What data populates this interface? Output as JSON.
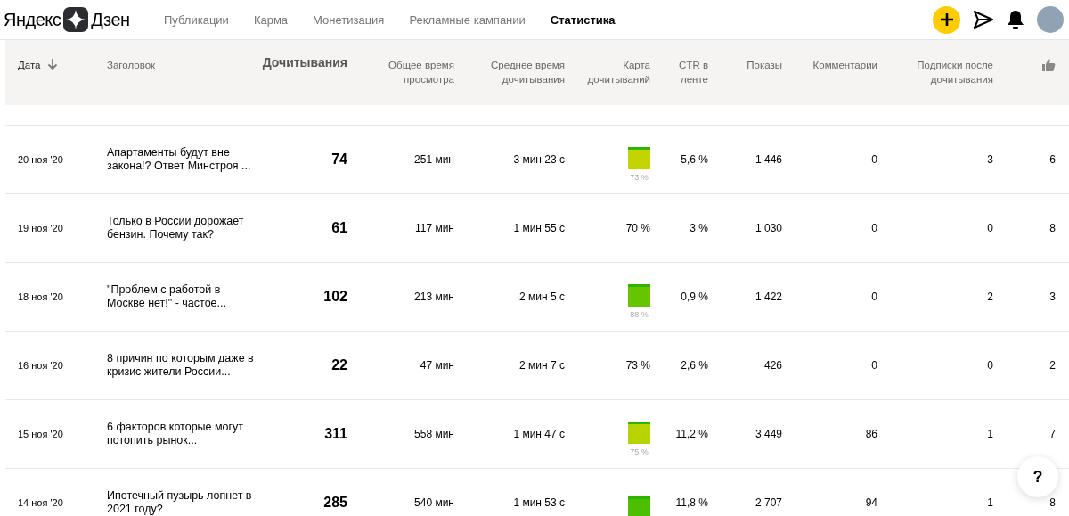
{
  "logo": {
    "left": "Яндекс",
    "right": "Дзен"
  },
  "nav": [
    {
      "label": "Публикации",
      "selected": false
    },
    {
      "label": "Карма",
      "selected": false
    },
    {
      "label": "Монетизация",
      "selected": false
    },
    {
      "label": "Рекламные кампании",
      "selected": false
    },
    {
      "label": "Статистика",
      "selected": true
    }
  ],
  "columns": [
    {
      "label": "Дата",
      "sorted": true
    },
    {
      "label": "Заголовок",
      "sorted": false
    },
    {
      "label": "Дочитывания",
      "sorted": false
    },
    {
      "label": "Общее время просмотра",
      "sorted": false
    },
    {
      "label": "Среднее время дочитывания",
      "sorted": false
    },
    {
      "label": "Карта дочитываний",
      "sorted": false
    },
    {
      "label": "CTR в ленте",
      "sorted": false
    },
    {
      "label": "Показы",
      "sorted": false
    },
    {
      "label": "Комментарии",
      "sorted": false
    },
    {
      "label": "Подписки после дочитывания",
      "sorted": false
    }
  ],
  "rows": [
    {
      "date": "20 ноя '20",
      "title": "Апартаменты будут вне закона!? Ответ Минстроя ...",
      "reads": "74",
      "total_time": "251 мин",
      "avg_time": "3 мин 23 с",
      "map": {
        "kind": "square",
        "label": "73 %",
        "color": "#c3d400"
      },
      "ctr": "5,6 %",
      "shows": "1 446",
      "comments": "0",
      "subs": "3",
      "likes": "6"
    },
    {
      "date": "19 ноя '20",
      "title": "Только в России дорожает бензин. Почему так?",
      "reads": "61",
      "total_time": "117 мин",
      "avg_time": "1 мин 55 с",
      "map": {
        "kind": "text",
        "label": "70 %"
      },
      "ctr": "3 %",
      "shows": "1 030",
      "comments": "0",
      "subs": "0",
      "likes": "8"
    },
    {
      "date": "18 ноя '20",
      "title": "\"Проблем с работой в Москве нет!\" - частое...",
      "reads": "102",
      "total_time": "213 мин",
      "avg_time": "2 мин 5 с",
      "map": {
        "kind": "square",
        "label": "88 %",
        "color": "#66c400"
      },
      "ctr": "0,9 %",
      "shows": "1 422",
      "comments": "0",
      "subs": "2",
      "likes": "3"
    },
    {
      "date": "16 ноя '20",
      "title": "8 причин по которым даже в кризис жители России...",
      "reads": "22",
      "total_time": "47 мин",
      "avg_time": "2 мин 7 с",
      "map": {
        "kind": "text",
        "label": "73 %"
      },
      "ctr": "2,6 %",
      "shows": "426",
      "comments": "0",
      "subs": "0",
      "likes": "2"
    },
    {
      "date": "15 ноя '20",
      "title": "6 факторов которые могут потопить рынок...",
      "reads": "311",
      "total_time": "558 мин",
      "avg_time": "1 мин 47 с",
      "map": {
        "kind": "square",
        "label": "75 %",
        "color": "#b8d400"
      },
      "ctr": "11,2 %",
      "shows": "3 449",
      "comments": "86",
      "subs": "1",
      "likes": "7"
    },
    {
      "date": "14 ноя '20",
      "title": "Ипотечный пузырь лопнет в 2021 году?",
      "reads": "285",
      "total_time": "540 мин",
      "avg_time": "1 мин 53 с",
      "map": {
        "kind": "square",
        "color": "#4cbf00"
      },
      "ctr": "11,8 %",
      "shows": "2 707",
      "comments": "94",
      "subs": "1",
      "likes": "8"
    }
  ],
  "help": "?"
}
